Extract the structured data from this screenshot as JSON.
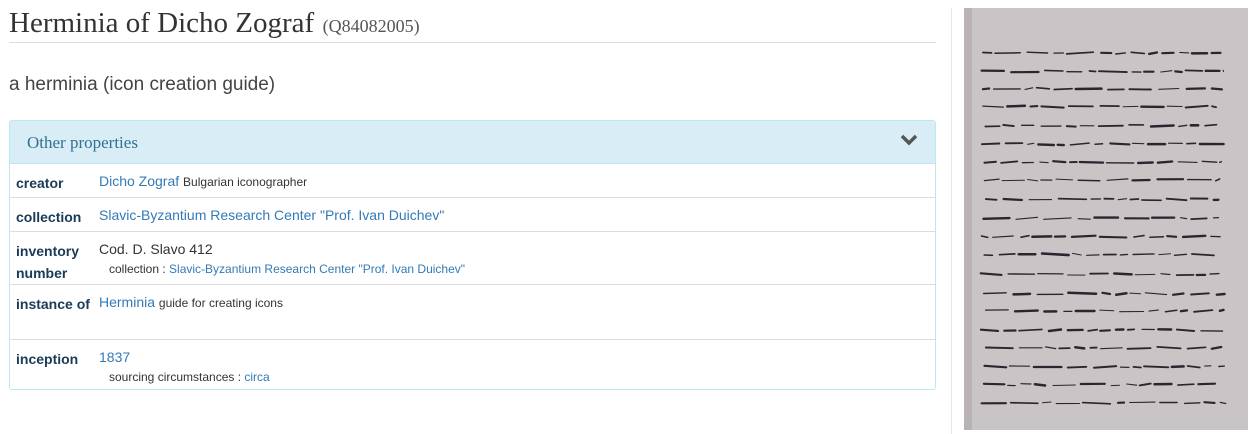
{
  "header": {
    "title": "Herminia of Dicho Zograf",
    "qid": "(Q84082005)"
  },
  "description": "a herminia (icon creation guide)",
  "panel": {
    "title": "Other properties",
    "rows": [
      {
        "property": "creator",
        "value": "Dicho Zograf",
        "value_description": "Bulgarian iconographer"
      },
      {
        "property": "collection",
        "value": "Slavic-Byzantium Research Center \"Prof. Ivan Duichev\""
      },
      {
        "property": "inventory number",
        "value": "Cod. D. Slavo 412",
        "qualifier_label": "collection :",
        "qualifier_value": "Slavic-Byzantium Research Center \"Prof. Ivan Duichev\""
      },
      {
        "property": "instance of",
        "value": "Herminia",
        "value_description": "guide for creating icons"
      },
      {
        "property": "inception",
        "value": "1837",
        "qualifier_label": "sourcing circumstances :",
        "qualifier_value": "circa"
      }
    ]
  },
  "icons": {
    "collapse": "chevron-down-icon"
  },
  "image": {
    "subject": "handwritten Cyrillic manuscript page"
  }
}
